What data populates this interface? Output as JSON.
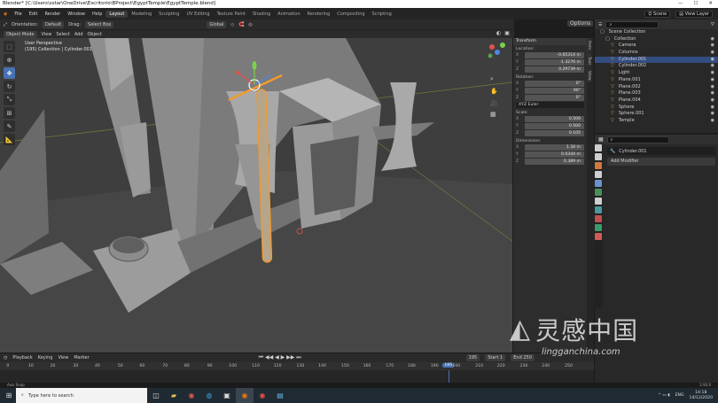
{
  "window": {
    "title": "Blender* [C:\\Users\\sstar\\OneDrive\\Escritorio\\BProject\\EgyptTemple\\EgyptTemple.blend]",
    "min": "—",
    "max": "☐",
    "close": "✕"
  },
  "menu": [
    "File",
    "Edit",
    "Render",
    "Window",
    "Help"
  ],
  "workspaces": [
    "Layout",
    "Modeling",
    "Sculpting",
    "UV Editing",
    "Texture Paint",
    "Shading",
    "Animation",
    "Rendering",
    "Compositing",
    "Scripting"
  ],
  "active_workspace": "Layout",
  "scene": {
    "label": "Scene",
    "layer_label": "View Layer"
  },
  "vp_toolbar": {
    "orientation": "Orientation:",
    "orientation_val": "Default",
    "drag": "Drag:",
    "drag_val": "Select Box",
    "transform_space": "Global",
    "options": "Options"
  },
  "vp_header": {
    "mode": "Object Mode",
    "view": "View",
    "select": "Select",
    "add": "Add",
    "object": "Object"
  },
  "vp_info": {
    "line1": "User Perspective",
    "line2": "(195) Collection | Cylinder.001"
  },
  "npanel": {
    "section": "Transform",
    "location": "Location:",
    "loc": [
      {
        "k": "X",
        "v": "-0.65314 m"
      },
      {
        "k": "Y",
        "v": "-1.3276 m"
      },
      {
        "k": "Z",
        "v": "0.29739 m"
      }
    ],
    "rotation": "Rotation:",
    "rot": [
      {
        "k": "X",
        "v": "0°"
      },
      {
        "k": "Y",
        "v": "90°"
      },
      {
        "k": "Z",
        "v": "0°"
      }
    ],
    "rot_mode": "XYZ Euler",
    "scale": "Scale:",
    "scl": [
      {
        "k": "X",
        "v": "0.500"
      },
      {
        "k": "Y",
        "v": "0.500"
      },
      {
        "k": "Z",
        "v": "0.105"
      }
    ],
    "dimensions": "Dimensions:",
    "dim": [
      {
        "k": "X",
        "v": "1.34 m"
      },
      {
        "k": "Y",
        "v": "0.0344 m"
      },
      {
        "k": "Z",
        "v": "0.389 m"
      }
    ],
    "tabs": [
      "Item",
      "Tool",
      "View"
    ]
  },
  "outliner": {
    "root": "Scene Collection",
    "collection": "Collection",
    "items": [
      {
        "name": "Camera",
        "sel": false
      },
      {
        "name": "Columns",
        "sel": false
      },
      {
        "name": "Cylinder.001",
        "sel": true
      },
      {
        "name": "Cylinder.002",
        "sel": false
      },
      {
        "name": "Light",
        "sel": false
      },
      {
        "name": "Plane.001",
        "sel": false
      },
      {
        "name": "Plane.002",
        "sel": false
      },
      {
        "name": "Plane.003",
        "sel": false
      },
      {
        "name": "Plane.004",
        "sel": false
      },
      {
        "name": "Sphere",
        "sel": false
      },
      {
        "name": "Sphere.001",
        "sel": false
      },
      {
        "name": "Temple",
        "sel": false
      }
    ]
  },
  "properties": {
    "object_name": "Cylinder.001",
    "add_modifier": "Add Modifier",
    "icon_colors": [
      "#cfcfcf",
      "#cfcfcf",
      "#d07a3f",
      "#cfcfcf",
      "#6e8fd0",
      "#4a8f5a",
      "#cfcfcf",
      "#4a9aa0",
      "#c05050",
      "#3a9a6a",
      "#d05a5a"
    ]
  },
  "timeline": {
    "playback": "Playback",
    "keying": "Keying",
    "view": "View",
    "marker": "Marker",
    "current": "195",
    "start_label": "Start",
    "start": "1",
    "end_label": "End",
    "end": "250"
  },
  "ruler": [
    "0",
    "10",
    "20",
    "30",
    "40",
    "50",
    "60",
    "70",
    "80",
    "90",
    "100",
    "110",
    "120",
    "130",
    "140",
    "150",
    "160",
    "170",
    "180",
    "190",
    "195",
    "200",
    "210",
    "220",
    "230",
    "240",
    "250"
  ],
  "status": {
    "left": "Axis Snap",
    "right": "2.93.0"
  },
  "taskbar": {
    "search": "Type here to search",
    "time": "14:18",
    "date": "14/12/2020",
    "lang": "ENG"
  },
  "watermark": {
    "cn": "灵感中国",
    "url": "lingganchina.com"
  }
}
